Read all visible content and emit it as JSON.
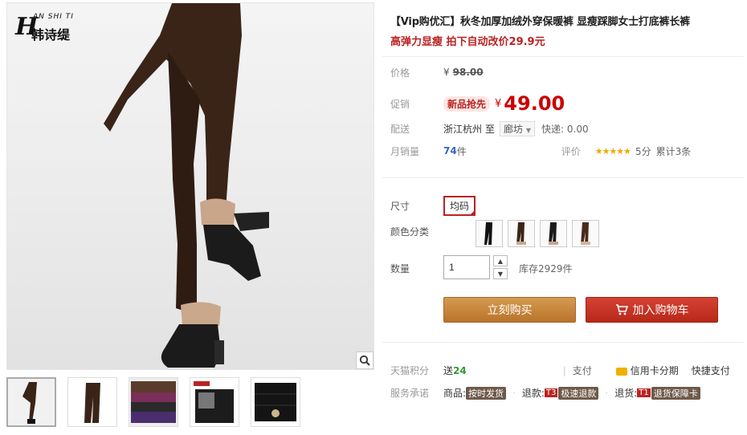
{
  "brand": {
    "mark": "H",
    "small": "AN SHI TI",
    "name": "韩诗缇"
  },
  "product": {
    "title": "【Vip购优汇】秋冬加厚加绒外穿保暖裤 显瘦踩脚女士打底裤长裤",
    "subtitle": "高弹力显瘦 拍下自动改价29.9元"
  },
  "price": {
    "label": "价格",
    "currency": "¥",
    "original": "98.00"
  },
  "promo": {
    "label": "促销",
    "badge": "新品抢先",
    "currency": "¥",
    "value": "49.00"
  },
  "shipping": {
    "label": "配送",
    "from": "浙江杭州",
    "to_word": "至",
    "destination": "廊坊",
    "fee_text": "快递: 0.00"
  },
  "sales": {
    "label": "月销量",
    "count": "74",
    "unit": "件"
  },
  "rating": {
    "label": "评价",
    "stars": "★★★★★",
    "score": "5分",
    "total": "累计3条"
  },
  "size": {
    "label": "尺寸",
    "option": "均码"
  },
  "color": {
    "label": "颜色分类",
    "options": [
      "黑色",
      "咖啡色",
      "黑色踩脚",
      "咖啡色踩脚"
    ]
  },
  "quantity": {
    "label": "数量",
    "value": "1",
    "stock": "库存2929件",
    "up": "▲",
    "down": "▼"
  },
  "actions": {
    "buy": "立刻购买",
    "cart": "加入购物车"
  },
  "points": {
    "label": "天猫积分",
    "prefix": "送",
    "value": "24"
  },
  "payment": {
    "label": "支付",
    "credit": "信用卡分期",
    "quick": "快捷支付"
  },
  "promise": {
    "label": "服务承诺",
    "goods_label": "商品:",
    "goods_tag": "按时发货",
    "refund_label": "退款:",
    "refund_t": "T3",
    "refund_tag": "极速退款",
    "return_label": "退货:",
    "return_t": "T1",
    "return_tag": "退货保障卡"
  },
  "colors": {
    "accent": "#cc0000",
    "buy": "#c4843a",
    "cart": "#c0301f",
    "product": "#3a2418"
  }
}
